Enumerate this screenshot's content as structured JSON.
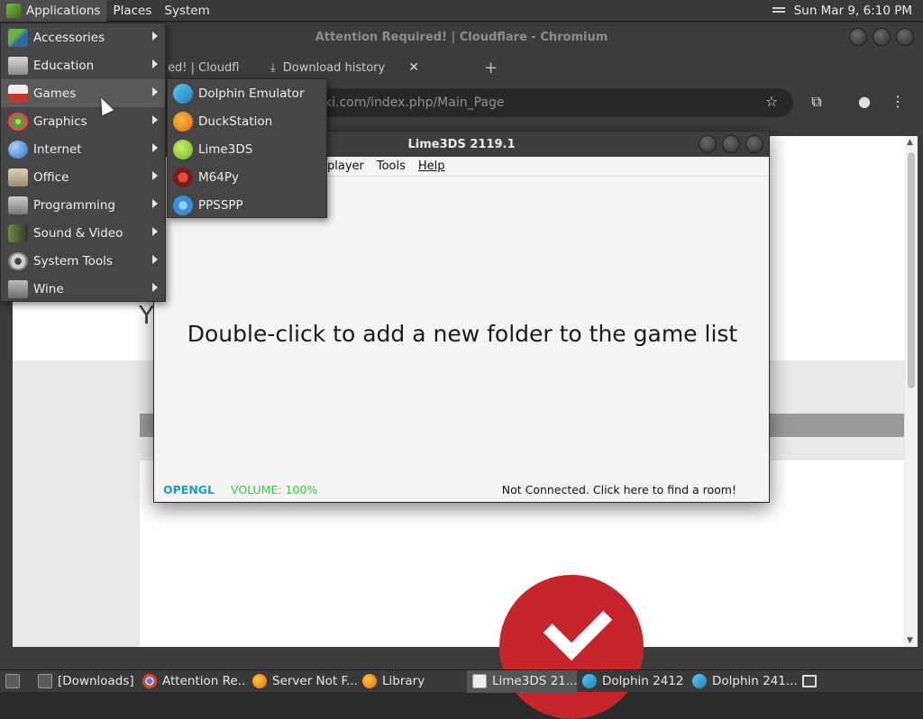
{
  "top_panel": {
    "menus": [
      "Applications",
      "Places",
      "System"
    ],
    "clock": "Sun Mar 9,  6:10 PM",
    "tray_icon": "network-icon"
  },
  "browser": {
    "window_title": "Attention Required! | Cloudflare - Chromium",
    "tabs": [
      {
        "label": "ed! | Cloudfl",
        "active": false
      },
      {
        "label": "Download history",
        "active": true
      }
    ],
    "url_visible": "ki.com/index.php/Main_Page",
    "url_prefix": "",
    "page_letter": "Y"
  },
  "app_menu": {
    "items": [
      {
        "label": "Accessories",
        "icon": "accessories-icon"
      },
      {
        "label": "Education",
        "icon": "education-icon"
      },
      {
        "label": "Games",
        "icon": "games-icon"
      },
      {
        "label": "Graphics",
        "icon": "graphics-icon"
      },
      {
        "label": "Internet",
        "icon": "internet-icon"
      },
      {
        "label": "Office",
        "icon": "office-icon"
      },
      {
        "label": "Programming",
        "icon": "programming-icon"
      },
      {
        "label": "Sound & Video",
        "icon": "sound-video-icon"
      },
      {
        "label": "System Tools",
        "icon": "system-tools-icon"
      },
      {
        "label": "Wine",
        "icon": "wine-icon"
      }
    ],
    "games_submenu": [
      {
        "label": "Dolphin Emulator",
        "icon": "dolphin-icon"
      },
      {
        "label": "DuckStation",
        "icon": "duckstation-icon"
      },
      {
        "label": "Lime3DS",
        "icon": "lime3ds-icon"
      },
      {
        "label": "M64Py",
        "icon": "m64py-icon"
      },
      {
        "label": "PPSSPP",
        "icon": "ppsspp-icon"
      }
    ]
  },
  "lime_window": {
    "title": "Lime3DS 2119.1",
    "menus": [
      "player",
      "Tools",
      "Help"
    ],
    "empty_message": "Double-click to add a new folder to the game list",
    "status_api": "OPENGL",
    "status_volume": "VOLUME: 100%",
    "status_network": "Not Connected. Click here to find a room!"
  },
  "taskbar": {
    "tasks": [
      {
        "label": "[Downloads]",
        "icon": "folder-icon"
      },
      {
        "label": "Attention Re...",
        "icon": "chromium-icon"
      },
      {
        "label": "Server Not F...",
        "icon": "firefox-icon"
      },
      {
        "label": "Library",
        "icon": "firefox-icon"
      },
      {
        "label": "Lime3DS 21...",
        "icon": "lime3ds-icon",
        "active": true
      },
      {
        "label": "Dolphin 2412",
        "icon": "dolphin-icon"
      },
      {
        "label": "Dolphin 241...",
        "icon": "dolphin-icon"
      }
    ]
  }
}
